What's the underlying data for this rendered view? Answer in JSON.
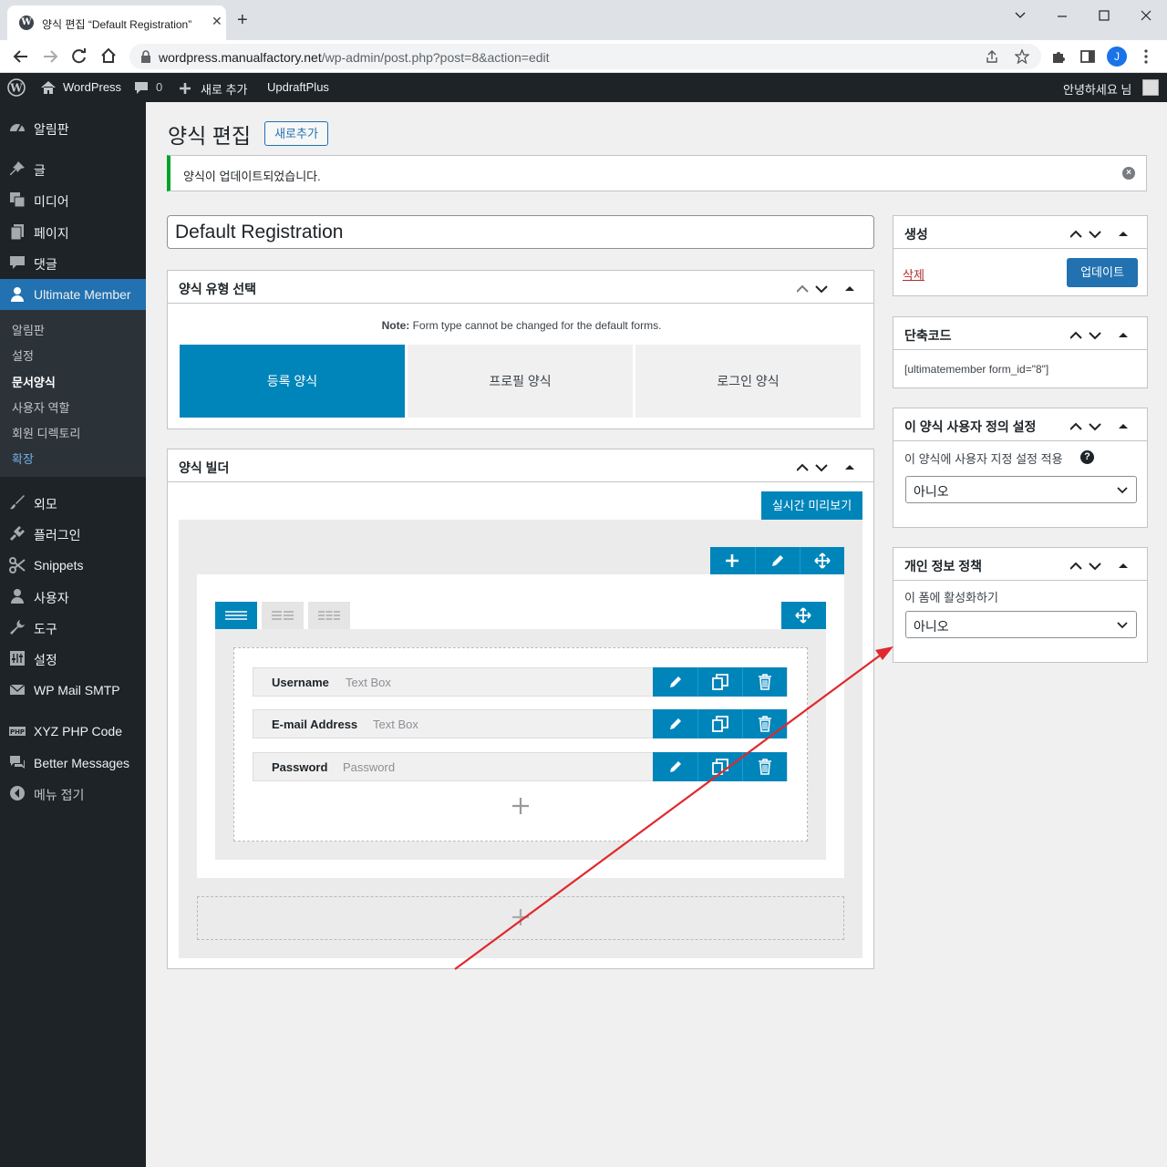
{
  "browser": {
    "tab_title": "양식 편집 “Default Registration”",
    "tab_favicon": "W",
    "tab_close": "✕",
    "newtab": "+",
    "url_host": "wordpress.manualfactory.net",
    "url_path": "/wp-admin/post.php?post=8&action=edit",
    "profile_initial": "J"
  },
  "adminbar": {
    "site": "WordPress",
    "comments": "0",
    "new": "새로 추가",
    "updraft": "UpdraftPlus",
    "greeting": "안녕하세요 님"
  },
  "sidebar": {
    "items": [
      {
        "label": "알림판",
        "icon": "dashboard-icon"
      },
      {
        "label": "글",
        "icon": "pin-icon"
      },
      {
        "label": "미디어",
        "icon": "media-icon"
      },
      {
        "label": "페이지",
        "icon": "page-icon"
      },
      {
        "label": "댓글",
        "icon": "comment-icon"
      },
      {
        "label": "Ultimate Member",
        "icon": "user-icon"
      },
      {
        "label": "외모",
        "icon": "brush-icon"
      },
      {
        "label": "플러그인",
        "icon": "plugin-icon"
      },
      {
        "label": "Snippets",
        "icon": "scissors-icon"
      },
      {
        "label": "사용자",
        "icon": "user-icon"
      },
      {
        "label": "도구",
        "icon": "wrench-icon"
      },
      {
        "label": "설정",
        "icon": "settings-icon"
      },
      {
        "label": "WP Mail SMTP",
        "icon": "mail-icon"
      },
      {
        "label": "XYZ PHP Code",
        "icon": "php-icon"
      },
      {
        "label": "Better Messages",
        "icon": "messages-icon"
      },
      {
        "label": "메뉴 접기",
        "icon": "collapse-icon"
      }
    ],
    "sub": [
      "알림판",
      "설정",
      "문서양식",
      "사용자 역할",
      "회원 디렉토리",
      "확장"
    ]
  },
  "page": {
    "title": "양식 편집",
    "add_new": "새로추가",
    "notice": "양식이 업데이트되었습니다.",
    "form_title": "Default Registration"
  },
  "formtype": {
    "title": "양식 유형 선택",
    "note_bold": "Note:",
    "note": "Form type cannot be changed for the default forms.",
    "tabs": [
      "등록 양식",
      "프로필 양식",
      "로그인 양식"
    ]
  },
  "builder": {
    "title": "양식 빌더",
    "preview": "실시간 미리보기",
    "fields": [
      {
        "name": "Username",
        "type": "Text Box"
      },
      {
        "name": "E-mail Address",
        "type": "Text Box"
      },
      {
        "name": "Password",
        "type": "Password"
      }
    ]
  },
  "publish": {
    "title": "생성",
    "delete": "삭제",
    "update": "업데이트"
  },
  "shortcode": {
    "title": "단축코드",
    "code": "[ultimatemember form_id=\"8\"]"
  },
  "custom": {
    "title": "이 양식 사용자 정의 설정",
    "label": "이 양식에 사용자 지정 설정 적용",
    "help": "?",
    "value": "아니오"
  },
  "privacy": {
    "title": "개인 정보 정책",
    "label": "이 폼에 활성화하기",
    "value": "아니오"
  },
  "colors": {
    "accent": "#0085ba",
    "admin_dark": "#1d2327",
    "active": "#2271b1",
    "arrow": "#e0282e"
  }
}
